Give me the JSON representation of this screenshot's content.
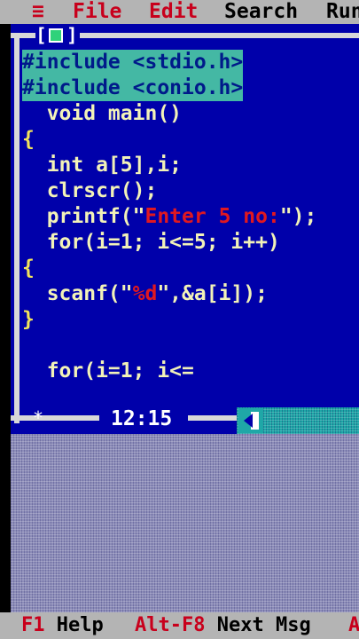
{
  "menu": {
    "system": "≡",
    "items": [
      {
        "label": "File"
      },
      {
        "label": "Edit"
      },
      {
        "label": "Search"
      },
      {
        "label": "Run"
      }
    ]
  },
  "window": {
    "left_bracket": "[",
    "right_bracket": "]",
    "resize_glyph": "*",
    "cursor_position": "12:15"
  },
  "code": {
    "lines": [
      {
        "text": "#include <stdio.h>"
      },
      {
        "text": "#include <conio.h>"
      },
      {
        "text": "  void main()"
      },
      {
        "text": "{"
      },
      {
        "text": "  int a[5],i;"
      },
      {
        "text": "  clrscr();"
      },
      {
        "pre": "  printf(\"",
        "str": "Enter 5 no:",
        "post": "\");"
      },
      {
        "text": "  for(i=1; i<=5; i++)"
      },
      {
        "text": "{"
      },
      {
        "pre": "  scanf(\"",
        "str": "%d",
        "post": "\",&a[i]);"
      },
      {
        "text": "}"
      },
      {
        "text": "  for(i=1; i<="
      }
    ]
  },
  "status": {
    "items": [
      {
        "key": "F1",
        "label": "Help"
      },
      {
        "key": "Alt-F8",
        "label": "Next Msg"
      },
      {
        "key": "Alt",
        "label": ""
      }
    ]
  },
  "colors": {
    "editor_bg": "#0000aa",
    "menu_bg": "#b4b4b4",
    "hotkey": "#c8001c",
    "selection_bg": "#44b8a4",
    "code_text": "#f2f2b8",
    "string_text": "#e01820"
  }
}
